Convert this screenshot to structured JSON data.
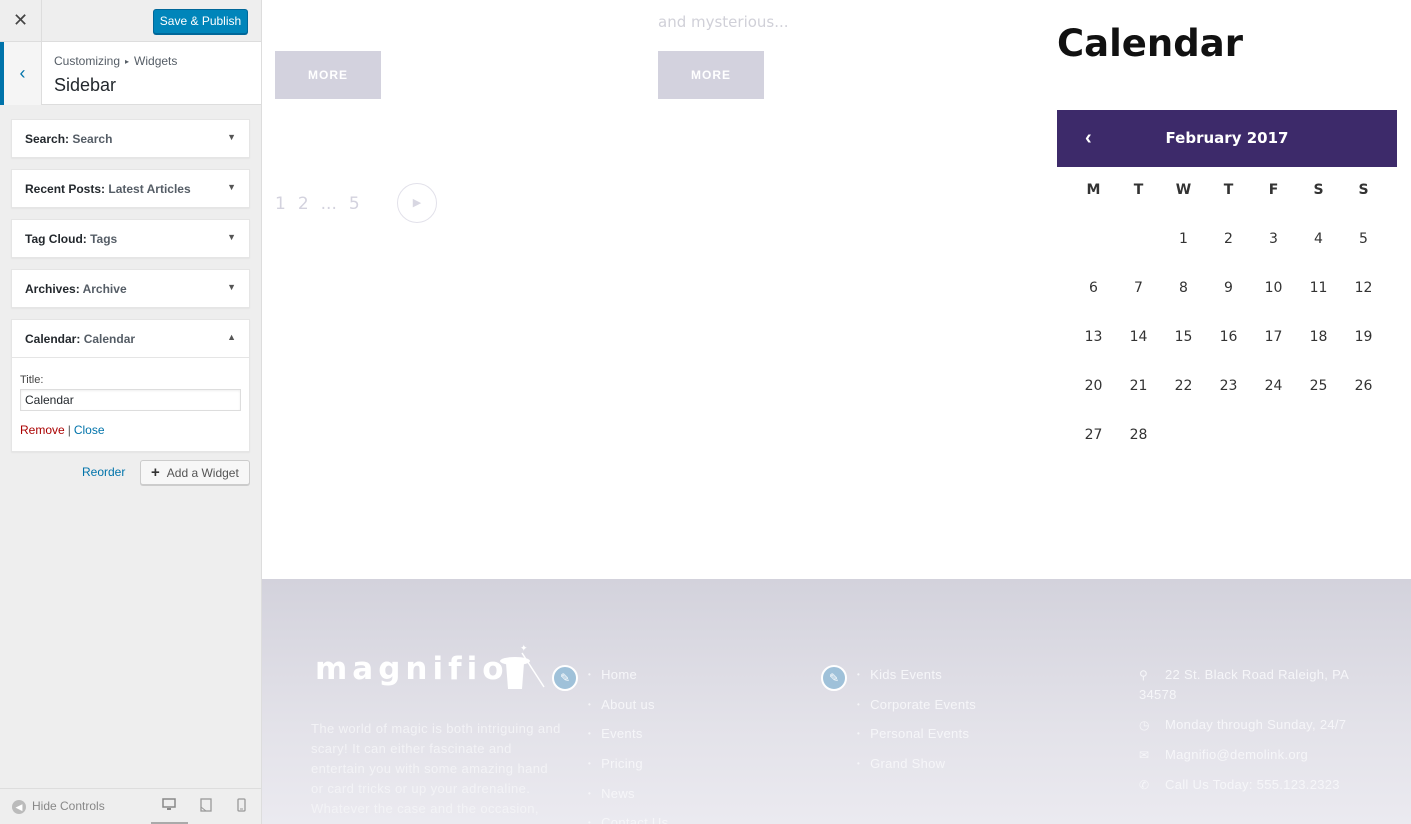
{
  "customizer": {
    "close_glyph": "✕",
    "save_label": "Save & Publish",
    "breadcrumb": [
      "Customizing",
      "Widgets"
    ],
    "breadcrumb_sep": "▸",
    "section_title": "Sidebar",
    "widgets": [
      {
        "type": "Search:",
        "title": "Search",
        "expanded": false
      },
      {
        "type": "Recent Posts:",
        "title": "Latest Articles",
        "expanded": false
      },
      {
        "type": "Tag Cloud:",
        "title": "Tags",
        "expanded": false
      },
      {
        "type": "Archives:",
        "title": "Archive",
        "expanded": false
      },
      {
        "type": "Calendar:",
        "title": "Calendar",
        "expanded": true
      }
    ],
    "calendar_form": {
      "title_label": "Title:",
      "title_value": "Calendar",
      "remove_label": "Remove",
      "close_label": "Close"
    },
    "reorder_label": "Reorder",
    "add_widget_label": "Add a Widget",
    "hide_controls_label": "Hide Controls",
    "colors": {
      "primary": "#0085ba",
      "link": "#0073aa",
      "remove": "#aa0000"
    }
  },
  "preview": {
    "faded_excerpt": "and mysterious...",
    "more_label": "MORE",
    "pagination": [
      "1",
      "2",
      "...",
      "5"
    ],
    "calendar": {
      "heading": "Calendar",
      "month": "February 2017",
      "weekdays": [
        "M",
        "T",
        "W",
        "T",
        "F",
        "S",
        "S"
      ],
      "weeks": [
        [
          "",
          "",
          "1",
          "2",
          "3",
          "4",
          "5"
        ],
        [
          "6",
          "7",
          "8",
          "9",
          "10",
          "11",
          "12"
        ],
        [
          "13",
          "14",
          "15",
          "16",
          "17",
          "18",
          "19"
        ],
        [
          "20",
          "21",
          "22",
          "23",
          "24",
          "25",
          "26"
        ],
        [
          "27",
          "28",
          "",
          "",
          "",
          "",
          ""
        ]
      ],
      "header_color": "#3d2a6a"
    },
    "footer": {
      "logo": "magnifio",
      "about": "The world of magic is both intriguing and scary! It can either fascinate and entertain you with some amazing hand or card tricks or up your adrenaline. Whatever the case and the occasion,",
      "menu1": [
        "Home",
        "About us",
        "Events",
        "Pricing",
        "News",
        "Contact Us"
      ],
      "menu2": [
        "Kids Events",
        "Corporate Events",
        "Personal Events",
        "Grand Show"
      ],
      "contact": [
        {
          "icon": "map-marker-icon",
          "text": "22 St. Black Road Raleigh, PA 34578"
        },
        {
          "icon": "clock-icon",
          "text": "Monday through Sunday, 24/7"
        },
        {
          "icon": "envelope-icon",
          "text": "Magnifio@demolink.org"
        },
        {
          "icon": "phone-icon",
          "text": "Call Us Today: 555.123.2323"
        }
      ]
    }
  }
}
